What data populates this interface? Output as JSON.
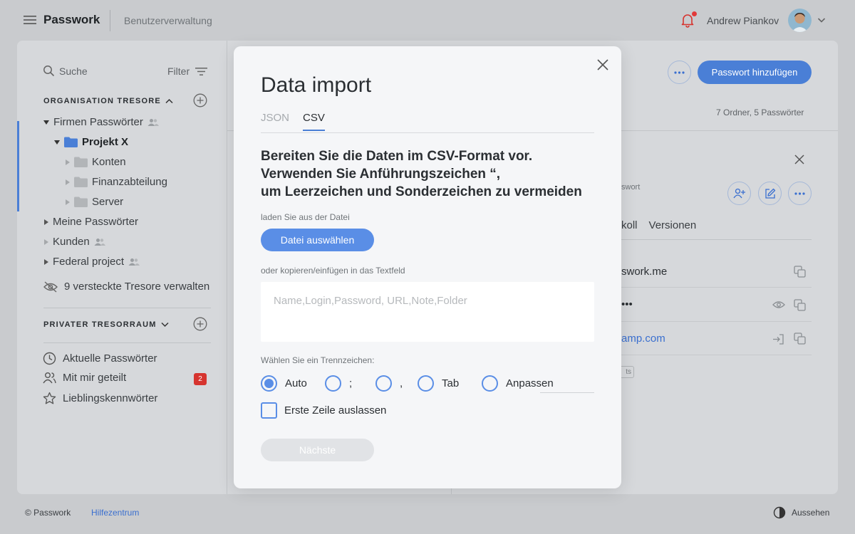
{
  "header": {
    "logo": "Passwork",
    "section": "Benutzerverwaltung",
    "user_name": "Andrew Piankov",
    "icons": [
      "hamburger-menu-icon",
      "bell-icon",
      "avatar",
      "chevron-down-icon"
    ]
  },
  "sidebar": {
    "search_label": "Suche",
    "filter_label": "Filter",
    "org_heading": "ORGANISATION TRESORE",
    "tree": [
      {
        "label": "Firmen Passwörter",
        "shared": true
      },
      {
        "label": "Projekt X"
      },
      {
        "label": "Konten"
      },
      {
        "label": "Finanzabteilung"
      },
      {
        "label": "Server"
      },
      {
        "label": "Meine Passwörter"
      },
      {
        "label": "Kunden",
        "shared": true
      },
      {
        "label": "Federal project",
        "shared": true
      }
    ],
    "hidden_vaults": "9 versteckte Tresore verwalten",
    "private_heading": "PRIVATER TRESORRAUM",
    "private_items": [
      {
        "label": "Aktuelle Passwörter",
        "icon": "clock-icon"
      },
      {
        "label": "Mit mir geteilt",
        "icon": "users-icon",
        "badge": "2"
      },
      {
        "label": "Lieblingskennwörter",
        "icon": "star-icon"
      }
    ],
    "accent_color": "#4a7fd6"
  },
  "main": {
    "add_password_button": "Passwort hinzufügen",
    "counts": "7 Ordner, 5 Passwörter"
  },
  "detail": {
    "subtitle_fragment": "swort",
    "tabs": [
      "koll",
      "Versionen"
    ],
    "fields": [
      "swork.me",
      "•••",
      "amp.com"
    ],
    "tag_fragment": "ts"
  },
  "footer": {
    "copyright": "© Passwork",
    "help": "Hilfezentrum",
    "theme": "Aussehen"
  },
  "modal": {
    "title": "Data import",
    "tabs": [
      "JSON",
      "CSV"
    ],
    "active_tab": "CSV",
    "heading_lines": [
      "Bereiten Sie die Daten im CSV-Format vor.",
      "Verwenden Sie Anführungszeichen “,",
      "um Leerzeichen und Sonderzeichen zu vermeiden"
    ],
    "file_label": "laden Sie aus der Datei",
    "file_button": "Datei auswählen",
    "paste_label": "oder kopieren/einfügen in das Textfeld",
    "textarea_placeholder": "Name,Login,Password, URL,Note,Folder",
    "separator_label": "Wählen Sie ein Trennzeichen:",
    "separators": [
      "Auto",
      ";",
      ",",
      "Tab",
      "Anpassen"
    ],
    "selected_separator": "Auto",
    "skip_first_row": "Erste Zeile auslassen",
    "next_button": "Nächste",
    "accent_color": "#5a8ee6"
  }
}
